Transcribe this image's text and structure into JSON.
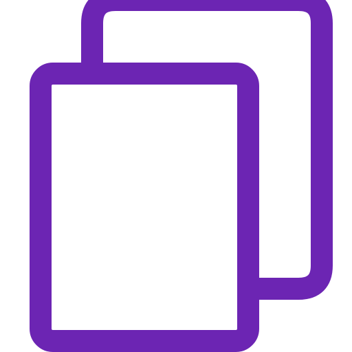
{
  "icon": {
    "name": "copy-icon",
    "color": "#6C25B3",
    "background": "#FFFFFF"
  }
}
